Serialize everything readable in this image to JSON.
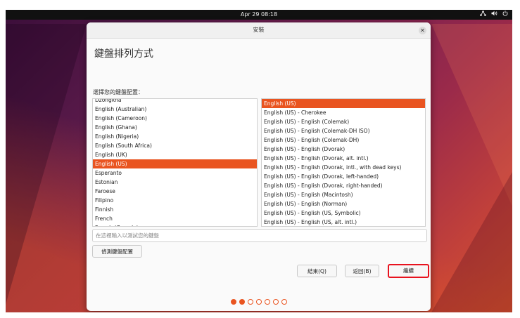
{
  "topbar": {
    "clock": "Apr 29  08:18",
    "icons": [
      "network-icon",
      "volume-icon",
      "power-icon"
    ]
  },
  "dialog": {
    "title": "安裝",
    "heading": "鍵盤排列方式",
    "select_label": "選擇您的鍵盤配置：",
    "layouts": [
      "Dzongkha",
      "English (Australian)",
      "English (Cameroon)",
      "English (Ghana)",
      "English (Nigeria)",
      "English (South Africa)",
      "English (UK)",
      "English (US)",
      "Esperanto",
      "Estonian",
      "Faroese",
      "Filipino",
      "Finnish",
      "French",
      "French (Canada)"
    ],
    "selected_layout": "English (US)",
    "variants": [
      "English (US)",
      "English (US) - Cherokee",
      "English (US) - English (Colemak)",
      "English (US) - English (Colemak-DH ISO)",
      "English (US) - English (Colemak-DH)",
      "English (US) - English (Dvorak)",
      "English (US) - English (Dvorak, alt. intl.)",
      "English (US) - English (Dvorak, intl., with dead keys)",
      "English (US) - English (Dvorak, left-handed)",
      "English (US) - English (Dvorak, right-handed)",
      "English (US) - English (Macintosh)",
      "English (US) - English (Norman)",
      "English (US) - English (US, Symbolic)",
      "English (US) - English (US, alt. intl.)"
    ],
    "selected_variant": "English (US)",
    "test_placeholder": "在這裡輸入以測試您的鍵盤",
    "detect_button": "偵測鍵盤配置",
    "quit_button": "結束(Q)",
    "back_button": "返回(B)",
    "continue_button": "繼續",
    "progress": {
      "current_step": 2,
      "total_steps": 7
    }
  },
  "colors": {
    "accent": "#e95420",
    "highlight_border": "#e8121e",
    "topbar": "#111111"
  }
}
